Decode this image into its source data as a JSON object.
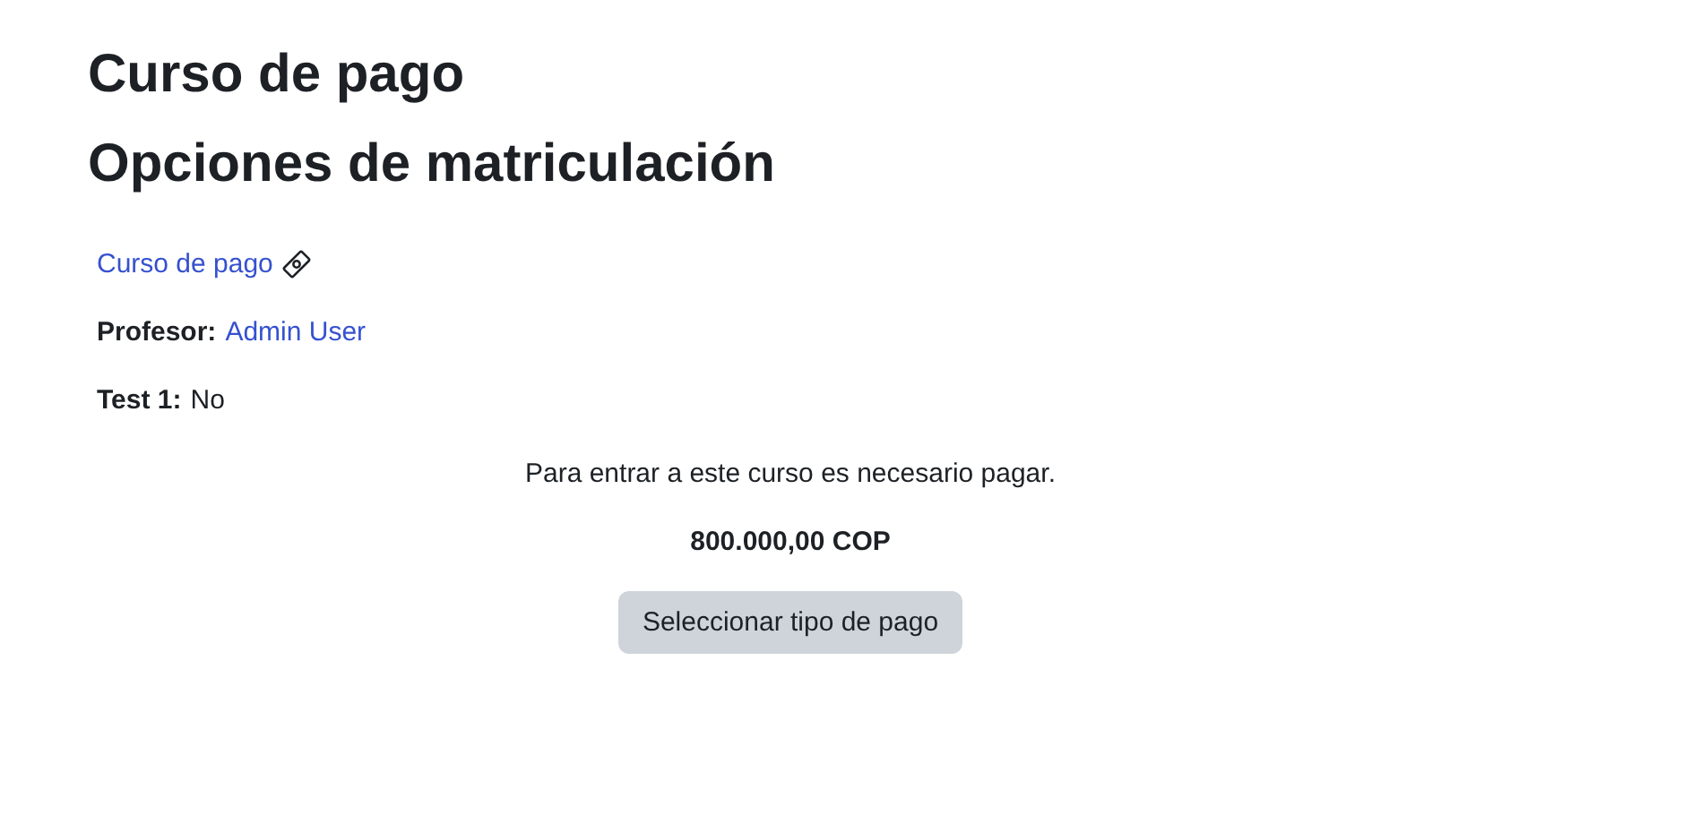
{
  "page_title": "Curso de pago",
  "section_title": "Opciones de matriculación",
  "course": {
    "link": "Curso de pago"
  },
  "fields": [
    {
      "kind": "link",
      "label": "Profesor:",
      "value": "Admin User"
    },
    {
      "kind": "text",
      "label": "Test 1:",
      "value": "No"
    }
  ],
  "payment": {
    "message": "Para entrar a este curso es necesario pagar.",
    "price": "800.000,00 COP",
    "button": "Seleccionar tipo de pago"
  }
}
